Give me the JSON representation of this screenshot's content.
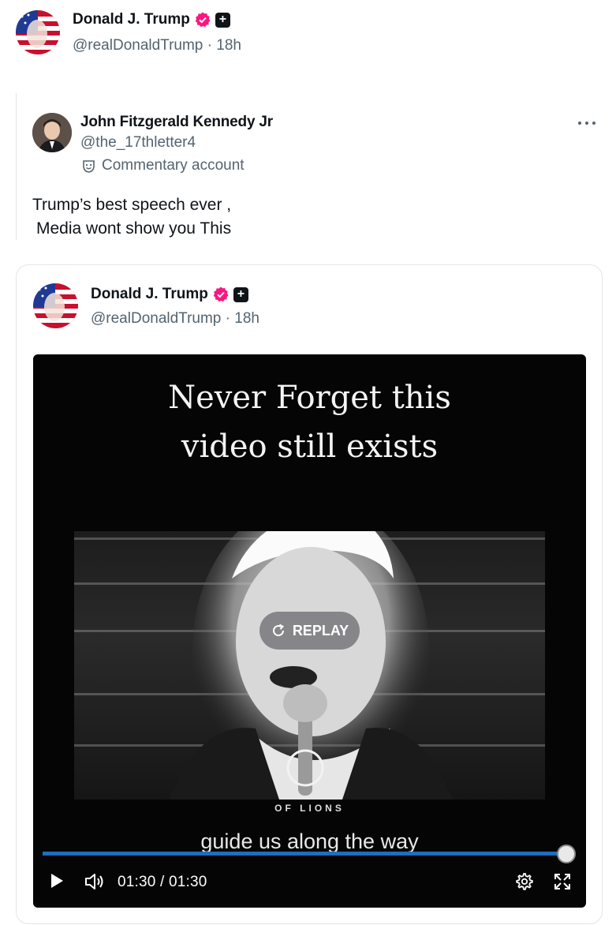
{
  "top_post": {
    "author_name": "Donald J. Trump",
    "handle_time": "@realDonaldTrump · 18h"
  },
  "quoted_post": {
    "author_name": "John Fitzgerald Kennedy Jr",
    "handle": "@the_17thletter4",
    "account_label": "Commentary account",
    "text_line1": "Trump’s best speech ever ,",
    "text_line2": "Media wont show you This"
  },
  "embedded_post": {
    "author_name": "Donald J. Trump",
    "handle_time": "@realDonaldTrump · 18h",
    "video": {
      "caption_line1": "Never Forget this",
      "caption_line2": "video still exists",
      "subtitle": "guide us along the way",
      "watermark": "OF LIONS",
      "replay_label": "REPLAY",
      "time": "01:30 / 01:30",
      "progress": 1.0
    }
  },
  "colors": {
    "verified_badge": "#f91880",
    "progress": "#1d6fbd",
    "secondary_text": "#536471"
  }
}
